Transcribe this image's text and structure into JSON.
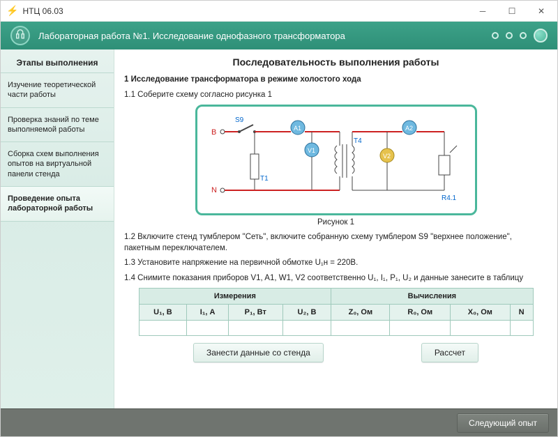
{
  "window": {
    "title": "НТЦ 06.03"
  },
  "header": {
    "title": "Лабораторная работа №1. Исследование однофазного трансформатора"
  },
  "sidebar": {
    "title": "Этапы выполнения",
    "items": [
      {
        "label": "Изучение теоретической части работы"
      },
      {
        "label": "Проверка знаний по теме выполняемой работы"
      },
      {
        "label": "Сборка схем выполнения опытов на виртуальной панели стенда"
      },
      {
        "label": "Проведение опыта лабораторной работы"
      }
    ],
    "active_index": 3
  },
  "main": {
    "title": "Последовательность выполнения работы",
    "section_heading": "1 Исследование трансформатора в режиме холостого хода",
    "step_1_1": "1.1 Соберите схему согласно рисунка 1",
    "figure_caption": "Рисунок 1",
    "step_1_2": "1.2 Включите стенд тумблером \"Сеть\", включите собранную схему  тумблером S9 \"верхнее положение\", пакетным переключателем.",
    "step_1_3": "1.3 Установите напряжение на первичной обмотке U₁н = 220В.",
    "step_1_4": "1.4 Снимите показания приборов  V1, A1, W1, V2 соответственно U₁, I₁, P₁, U₂ и данные занесите в таблицу",
    "table": {
      "group_measurements": "Измерения",
      "group_calculations": "Вычисления",
      "cols": [
        "U₁, В",
        "I₁, А",
        "P₁, Вт",
        "U₂, В",
        "Z₀, Ом",
        "R₀, Ом",
        "X₀, Ом",
        "N"
      ],
      "row": [
        "",
        "",
        "",
        "",
        "",
        "",
        "",
        ""
      ]
    },
    "btn_load": "Занести данные со стенда",
    "btn_calc": "Рассчет"
  },
  "footer": {
    "next": "Следующий опыт"
  },
  "circuit": {
    "labels": {
      "B": "B",
      "N": "N",
      "S9": "S9",
      "T1": "T1",
      "A1": "A1",
      "V1": "V1",
      "T4": "T4",
      "A2": "A2",
      "V2": "V2",
      "R41": "R4.1"
    }
  }
}
